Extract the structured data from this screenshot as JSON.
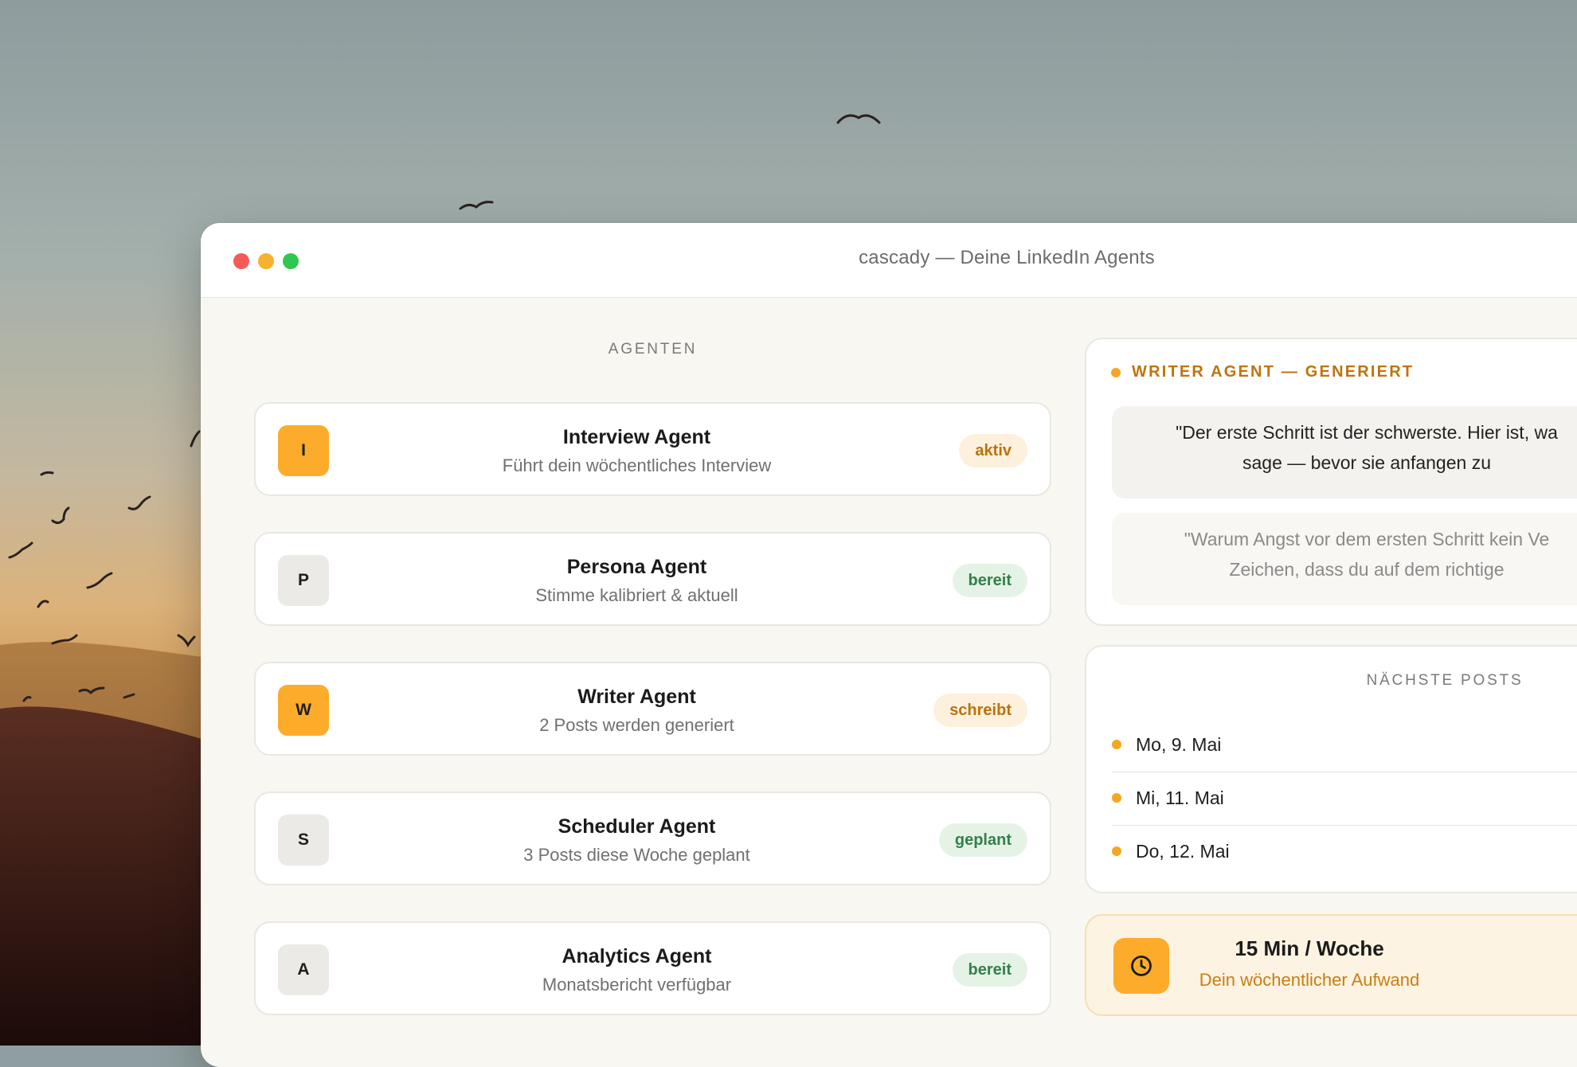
{
  "window": {
    "title": "cascady — Deine LinkedIn Agents"
  },
  "agents": {
    "heading": "AGENTEN",
    "items": [
      {
        "initial": "I",
        "name": "Interview Agent",
        "description": "Führt dein wöchentliches Interview",
        "status": "aktiv",
        "status_color": "#b77410",
        "avatar_color": "#fcab2b"
      },
      {
        "initial": "P",
        "name": "Persona Agent",
        "description": "Stimme kalibriert & aktuell",
        "status": "bereit",
        "status_color": "#33804a",
        "avatar_color": "#ebeae6"
      },
      {
        "initial": "W",
        "name": "Writer Agent",
        "description": "2 Posts werden generiert",
        "status": "schreibt",
        "status_color": "#b77410",
        "avatar_color": "#fcab2b"
      },
      {
        "initial": "S",
        "name": "Scheduler Agent",
        "description": "3 Posts diese Woche geplant",
        "status": "geplant",
        "status_color": "#33804a",
        "avatar_color": "#ebeae6"
      },
      {
        "initial": "A",
        "name": "Analytics Agent",
        "description": "Monatsbericht verfügbar",
        "status": "bereit",
        "status_color": "#33804a",
        "avatar_color": "#ebeae6"
      }
    ]
  },
  "writer": {
    "heading": "WRITER AGENT — GENERIERT",
    "drafts": [
      {
        "line1": "\"Der erste Schritt ist der schwerste. Hier ist, wa",
        "line2": "sage — bevor sie anfangen zu"
      },
      {
        "line1": "\"Warum Angst vor dem ersten Schritt kein Ve",
        "line2": "Zeichen, dass du auf dem richtige"
      }
    ]
  },
  "schedule": {
    "heading": "NÄCHSTE POSTS",
    "posts": [
      "Mo, 9. Mai",
      "Mi, 11. Mai",
      "Do, 12. Mai"
    ]
  },
  "effort": {
    "icon": "clock-icon",
    "title": "15 Min / Woche",
    "subtitle": "Dein wöchentlicher Aufwand"
  },
  "colors": {
    "accent": "#f5a623",
    "accent_text": "#bd7410",
    "success_text": "#33804a"
  }
}
